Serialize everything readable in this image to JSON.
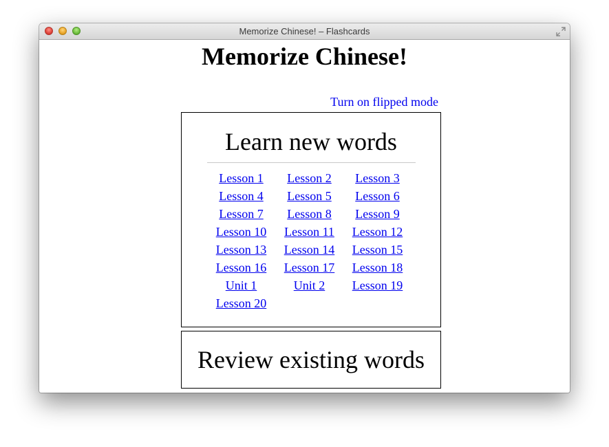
{
  "window": {
    "title": "Memorize Chinese! – Flashcards"
  },
  "page": {
    "heading": "Memorize Chinese!",
    "flip_link": "Turn on flipped mode"
  },
  "learn": {
    "heading": "Learn new words",
    "lessons": [
      "Lesson 1",
      "Lesson 2",
      "Lesson 3",
      "Lesson 4",
      "Lesson 5",
      "Lesson 6",
      "Lesson 7",
      "Lesson 8",
      "Lesson 9",
      "Lesson 10",
      "Lesson 11",
      "Lesson 12",
      "Lesson 13",
      "Lesson 14",
      "Lesson 15",
      "Lesson 16",
      "Lesson 17",
      "Lesson 18",
      "Unit 1",
      "Unit 2",
      "Lesson 19",
      "Lesson 20"
    ]
  },
  "review": {
    "heading": "Review existing words"
  },
  "colors": {
    "link": "#0000ee",
    "border": "#000000",
    "divider": "#c8c8c8"
  }
}
